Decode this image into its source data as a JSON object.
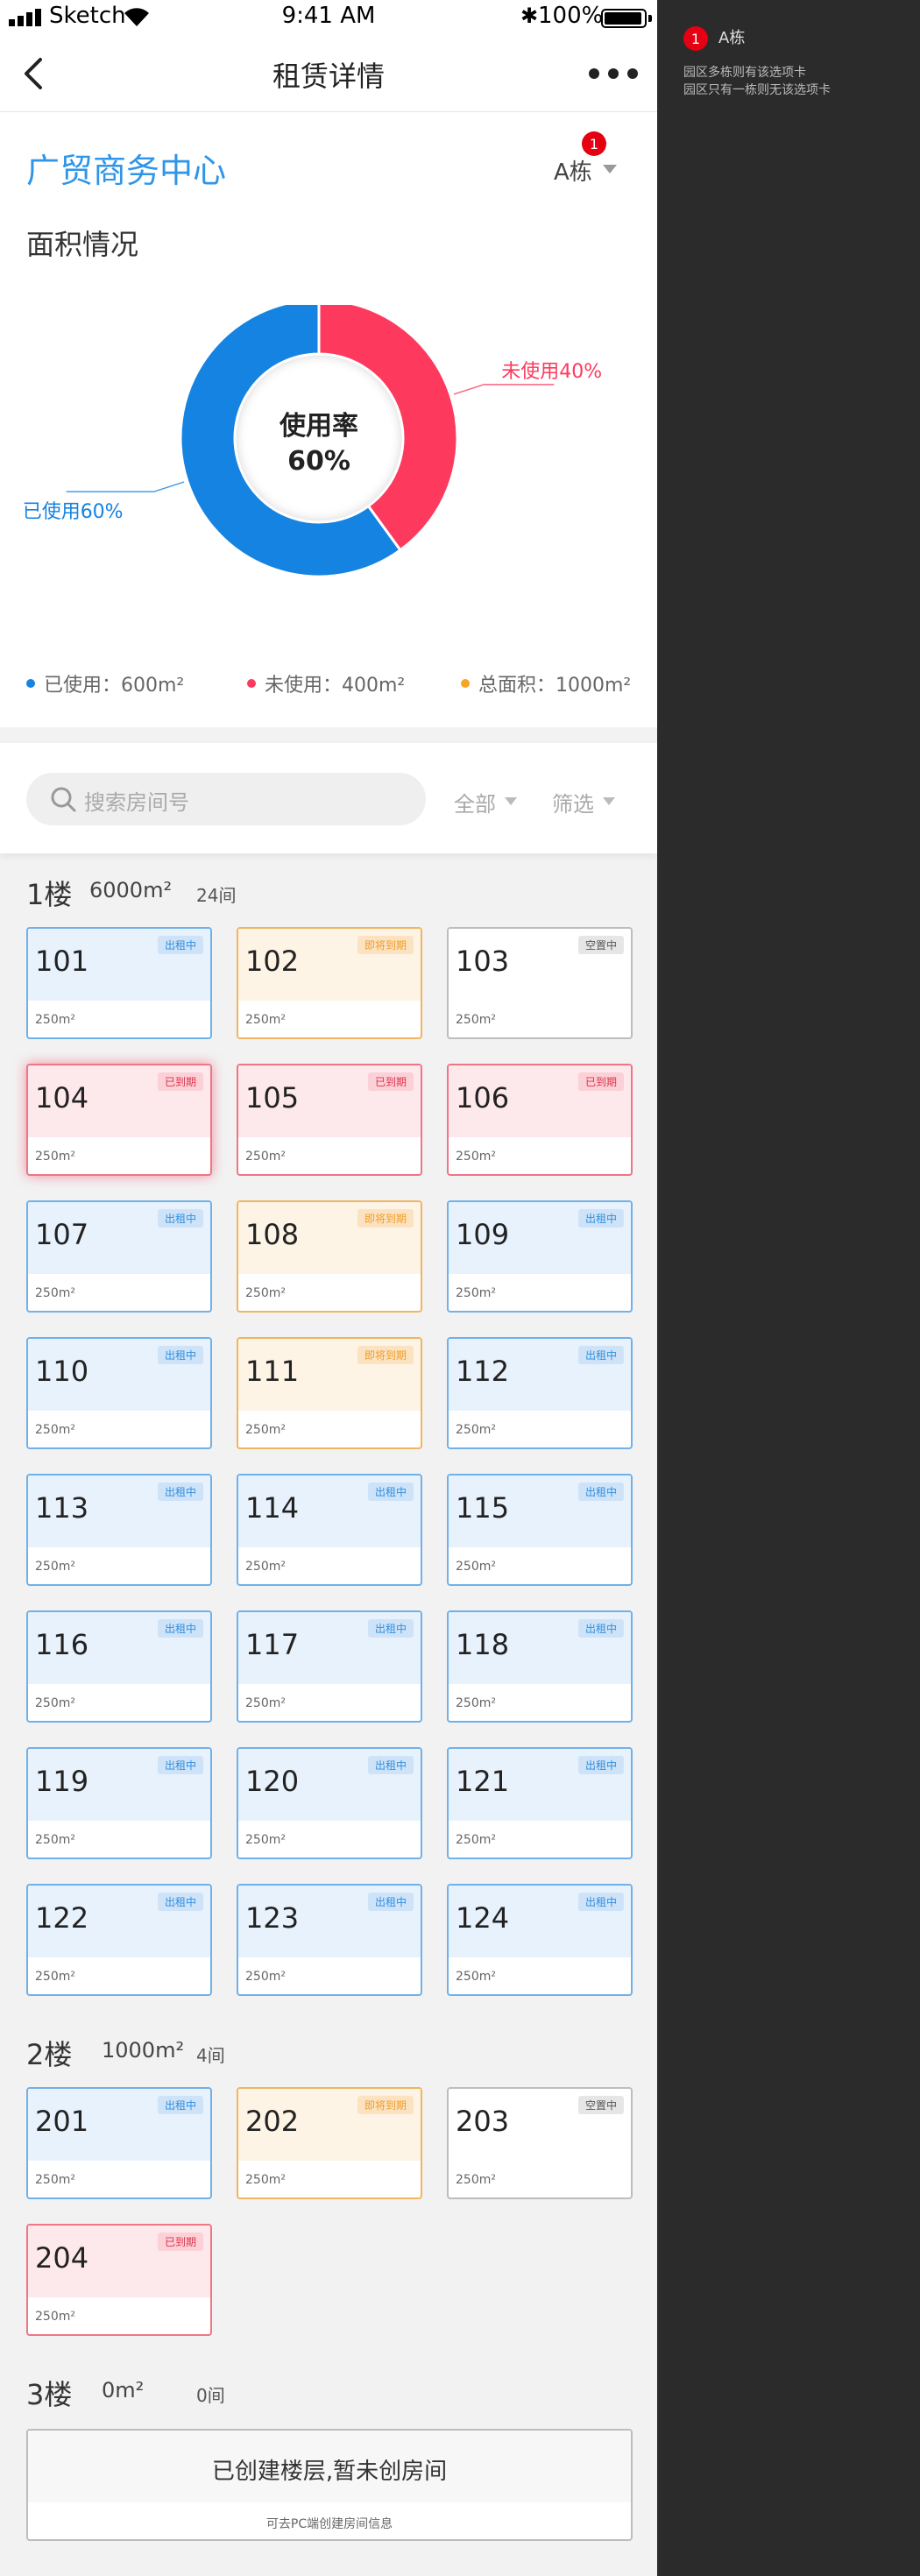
{
  "status_bar": {
    "carrier": "Sketch",
    "time": "9:41 AM",
    "battery": "100%"
  },
  "nav": {
    "title": "租赁详情"
  },
  "header": {
    "park_name": "广贸商务中心",
    "building": "A栋",
    "building_badge": "1"
  },
  "area_section": {
    "title": "面积情况"
  },
  "chart_data": {
    "type": "pie",
    "center_label": "使用率",
    "center_value": "60%",
    "slices": [
      {
        "label": "已使用60%",
        "value": 60,
        "color": "#1483e2"
      },
      {
        "label": "未使用40%",
        "value": 40,
        "color": "#fd3a5e"
      }
    ]
  },
  "legend": [
    {
      "text": "已使用：600m²",
      "color": "#1483e2"
    },
    {
      "text": "未使用：400m²",
      "color": "#fd3a5e"
    },
    {
      "text": "总面积：1000m²",
      "color": "#f5a623"
    }
  ],
  "search": {
    "placeholder": "搜索房间号",
    "filter_all": "全部",
    "filter_more": "筛选"
  },
  "floors": [
    {
      "name": "1楼",
      "area": "6000m²",
      "count": "24间",
      "rooms": [
        {
          "num": "101",
          "status": "出租中",
          "area": "250m²"
        },
        {
          "num": "102",
          "status": "即将到期",
          "area": "250m²"
        },
        {
          "num": "103",
          "status": "空置中",
          "area": "250m²"
        },
        {
          "num": "104",
          "status": "已到期",
          "area": "250m²"
        },
        {
          "num": "105",
          "status": "已到期",
          "area": "250m²"
        },
        {
          "num": "106",
          "status": "已到期",
          "area": "250m²"
        },
        {
          "num": "107",
          "status": "出租中",
          "area": "250m²"
        },
        {
          "num": "108",
          "status": "即将到期",
          "area": "250m²"
        },
        {
          "num": "109",
          "status": "出租中",
          "area": "250m²"
        },
        {
          "num": "110",
          "status": "出租中",
          "area": "250m²"
        },
        {
          "num": "111",
          "status": "即将到期",
          "area": "250m²"
        },
        {
          "num": "112",
          "status": "出租中",
          "area": "250m²"
        },
        {
          "num": "113",
          "status": "出租中",
          "area": "250m²"
        },
        {
          "num": "114",
          "status": "出租中",
          "area": "250m²"
        },
        {
          "num": "115",
          "status": "出租中",
          "area": "250m²"
        },
        {
          "num": "116",
          "status": "出租中",
          "area": "250m²"
        },
        {
          "num": "117",
          "status": "出租中",
          "area": "250m²"
        },
        {
          "num": "118",
          "status": "出租中",
          "area": "250m²"
        },
        {
          "num": "119",
          "status": "出租中",
          "area": "250m²"
        },
        {
          "num": "120",
          "status": "出租中",
          "area": "250m²"
        },
        {
          "num": "121",
          "status": "出租中",
          "area": "250m²"
        },
        {
          "num": "122",
          "status": "出租中",
          "area": "250m²"
        },
        {
          "num": "123",
          "status": "出租中",
          "area": "250m²"
        },
        {
          "num": "124",
          "status": "出租中",
          "area": "250m²"
        }
      ]
    },
    {
      "name": "2楼",
      "area": "1000m²",
      "count": "4间",
      "rooms": [
        {
          "num": "201",
          "status": "出租中",
          "area": "250m²"
        },
        {
          "num": "202",
          "status": "即将到期",
          "area": "250m²"
        },
        {
          "num": "203",
          "status": "空置中",
          "area": "250m²"
        },
        {
          "num": "204",
          "status": "已到期",
          "area": "250m²"
        }
      ]
    },
    {
      "name": "3楼",
      "area": "0m²",
      "count": "0间",
      "rooms": []
    }
  ],
  "empty_floor": {
    "main": "已创建楼层,暂未创房间",
    "sub": "可去PC端创建房间信息"
  },
  "side_panel": {
    "badge": "1",
    "title": "A栋",
    "notes": [
      "园区多栋则有该选项卡",
      "园区只有一栋则无该选项卡"
    ]
  }
}
